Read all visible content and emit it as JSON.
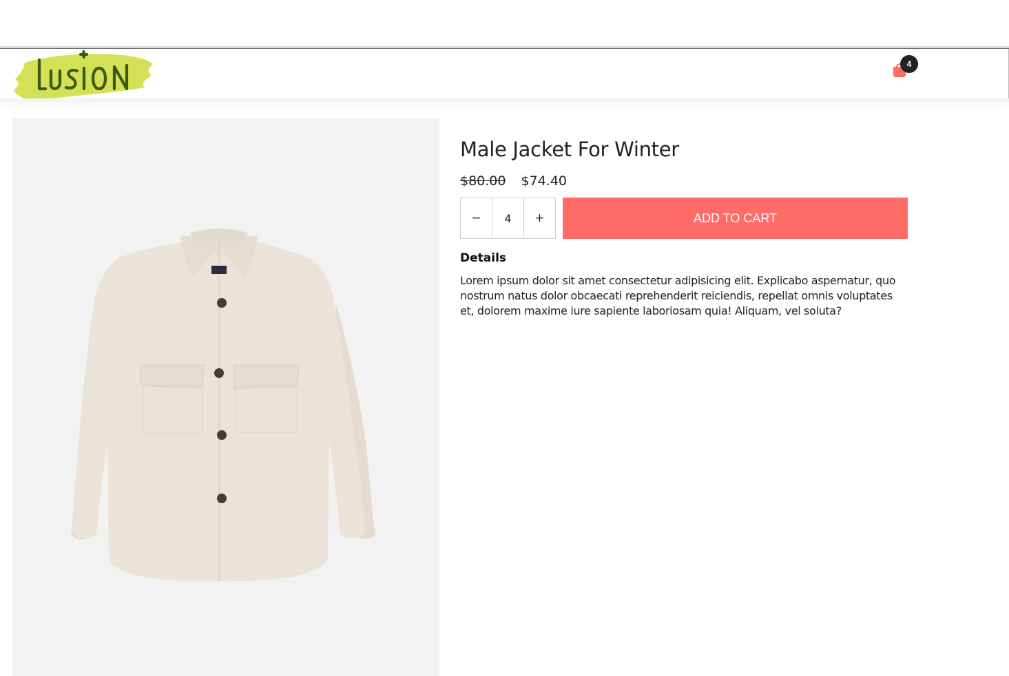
{
  "header": {
    "logo_text": "LUSION",
    "cart_count": "4"
  },
  "product": {
    "title": "Male Jacket For Winter",
    "old_price": "$80.00",
    "new_price": "$74.40",
    "quantity": "4",
    "decrement_label": "−",
    "increment_label": "+",
    "add_to_cart_label": "ADD TO CART",
    "details_heading": "Details",
    "details_text": "Lorem ipsum dolor sit amet consectetur adipisicing elit. Explicabo aspernatur, quo nostrum natus dolor obcaecati reprehenderit reiciendis, repellat omnis voluptates et, dolorem maxime iure sapiente laboriosam quia! Aliquam, vel soluta?"
  },
  "colors": {
    "accent": "#ff6b67",
    "logo_brush": "#d4e157",
    "logo_text": "#3a5a12",
    "badge": "#222222",
    "image_bg": "#f2f2f2"
  }
}
